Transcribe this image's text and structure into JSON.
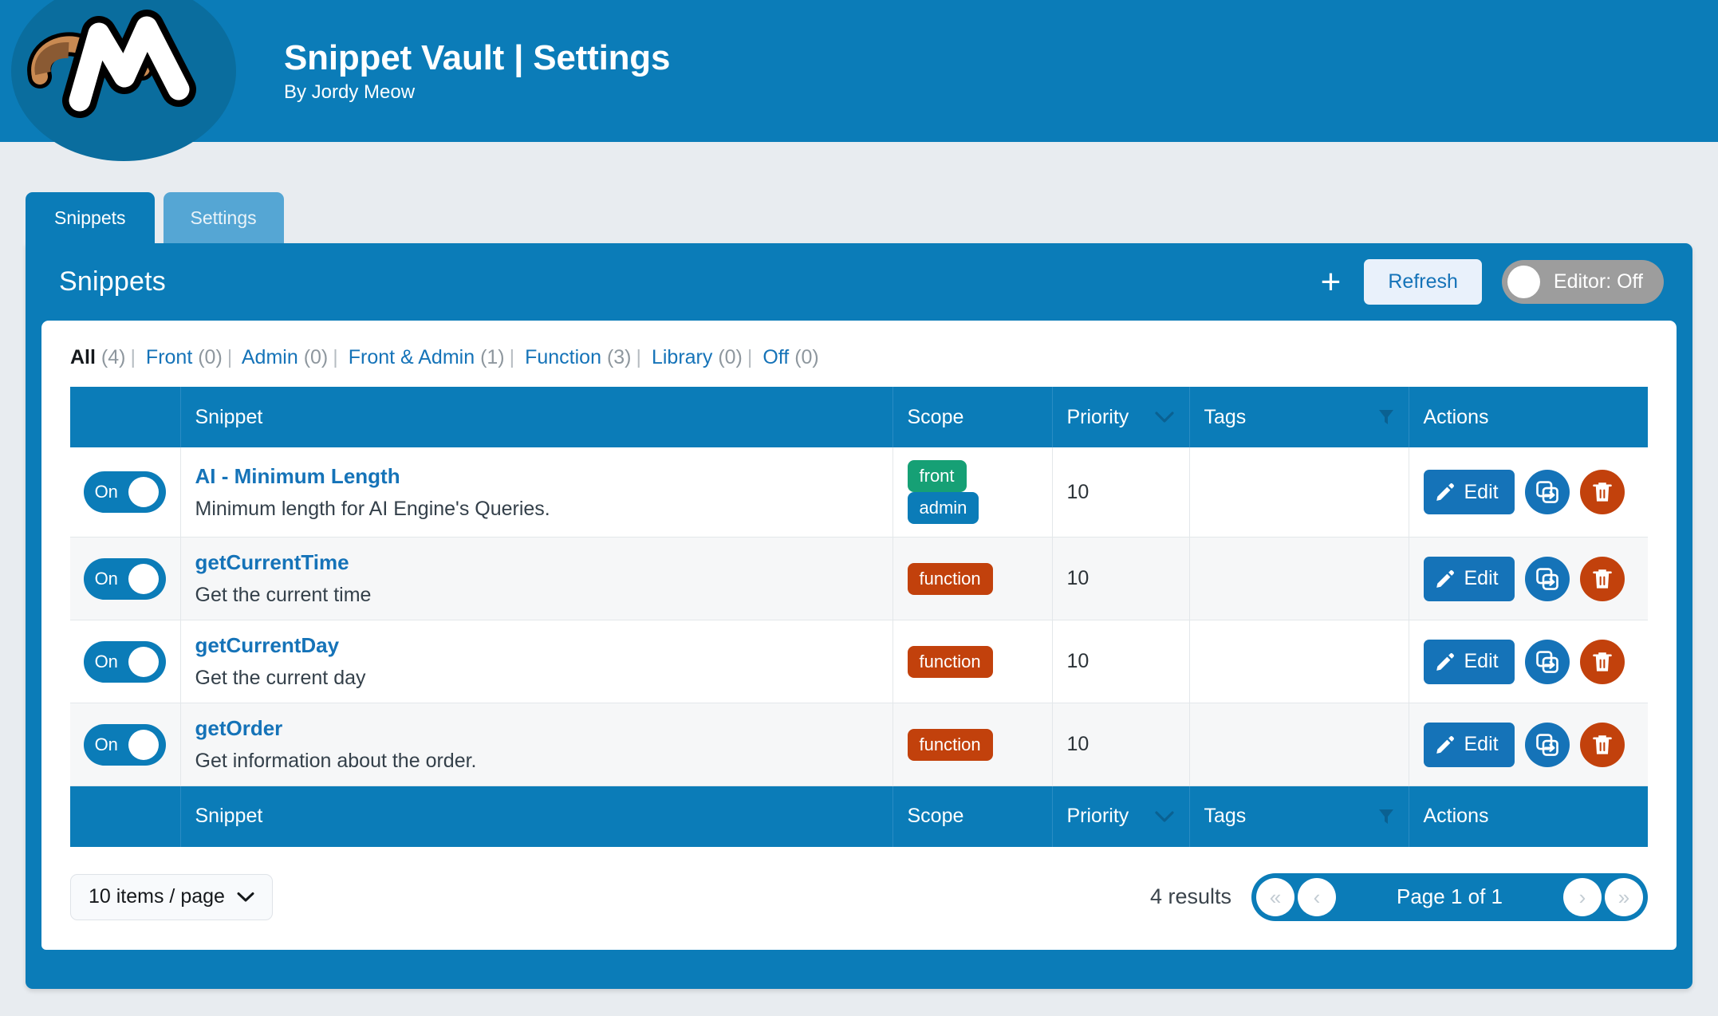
{
  "banner": {
    "title": "Snippet Vault | Settings",
    "subtitle": "By Jordy Meow",
    "logo_icon": "meow-apps-logo"
  },
  "tabs": [
    {
      "label": "Snippets",
      "active": true
    },
    {
      "label": "Settings",
      "active": false
    }
  ],
  "panel": {
    "title": "Snippets",
    "add_icon": "plus-icon",
    "refresh_label": "Refresh",
    "editor_toggle_label": "Editor: Off"
  },
  "filters": [
    {
      "label": "All",
      "count": "(4)",
      "active": true
    },
    {
      "label": "Front",
      "count": "(0)",
      "active": false
    },
    {
      "label": "Admin",
      "count": "(0)",
      "active": false
    },
    {
      "label": "Front & Admin",
      "count": "(1)",
      "active": false
    },
    {
      "label": "Function",
      "count": "(3)",
      "active": false
    },
    {
      "label": "Library",
      "count": "(0)",
      "active": false
    },
    {
      "label": "Off",
      "count": "(0)",
      "active": false
    }
  ],
  "table": {
    "columns": {
      "toggle": "",
      "snippet": "Snippet",
      "scope": "Scope",
      "priority": "Priority",
      "tags": "Tags",
      "actions": "Actions"
    },
    "sort_icon": "chevron-down-icon",
    "filter_icon": "funnel-icon",
    "rows": [
      {
        "toggle_label": "On",
        "name": "AI - Minimum Length",
        "description": "Minimum length for AI Engine's Queries.",
        "scope": [
          "front",
          "admin"
        ],
        "priority": "10",
        "tags": "",
        "edit_label": "Edit"
      },
      {
        "toggle_label": "On",
        "name": "getCurrentTime",
        "description": "Get the current time",
        "scope": [
          "function"
        ],
        "priority": "10",
        "tags": "",
        "edit_label": "Edit"
      },
      {
        "toggle_label": "On",
        "name": "getCurrentDay",
        "description": "Get the current day",
        "scope": [
          "function"
        ],
        "priority": "10",
        "tags": "",
        "edit_label": "Edit"
      },
      {
        "toggle_label": "On",
        "name": "getOrder",
        "description": "Get information about the order.",
        "scope": [
          "function"
        ],
        "priority": "10",
        "tags": "",
        "edit_label": "Edit"
      }
    ]
  },
  "footer": {
    "per_page_label": "10 items / page",
    "per_page_icon": "chevron-down-icon",
    "results_label": "4 results",
    "page_label": "Page 1 of 1",
    "first_icon": "«",
    "prev_icon": "‹",
    "next_icon": "›",
    "last_icon": "»"
  },
  "colors": {
    "brand_blue": "#0b7cb8",
    "link_blue": "#1573b8",
    "tab_inactive": "#55a6d4",
    "badge_front": "#16a075",
    "badge_admin": "#0b7cb8",
    "badge_function": "#c2410c",
    "delete_red": "#c2410c",
    "toggle_off_gray": "#9d9d9d",
    "page_bg": "#e8ecf0"
  }
}
